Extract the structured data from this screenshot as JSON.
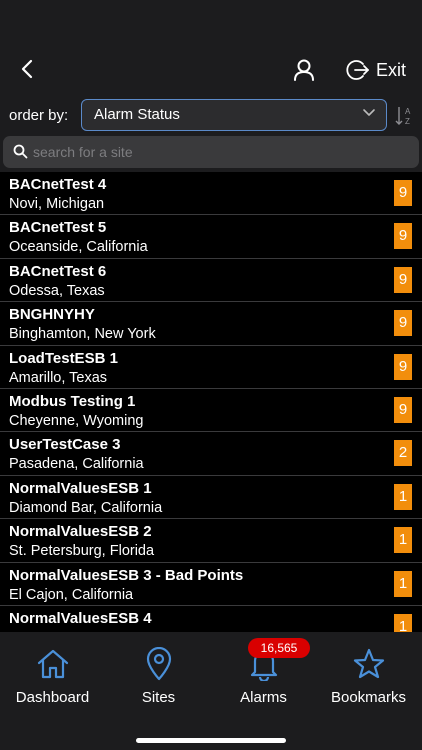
{
  "header": {
    "exit_label": "Exit"
  },
  "order": {
    "label": "order by:",
    "value": "Alarm Status"
  },
  "search": {
    "placeholder": "search for a site"
  },
  "sites": [
    {
      "name": "BACnetTest 4",
      "location": "Novi, Michigan",
      "alarms": "9"
    },
    {
      "name": "BACnetTest 5",
      "location": "Oceanside, California",
      "alarms": "9"
    },
    {
      "name": "BACnetTest 6",
      "location": "Odessa, Texas",
      "alarms": "9"
    },
    {
      "name": "BNGHNYHY",
      "location": "Binghamton, New York",
      "alarms": "9"
    },
    {
      "name": "LoadTestESB 1",
      "location": "Amarillo, Texas",
      "alarms": "9"
    },
    {
      "name": "Modbus Testing 1",
      "location": "Cheyenne, Wyoming",
      "alarms": "9"
    },
    {
      "name": "UserTestCase 3",
      "location": "Pasadena, California",
      "alarms": "2"
    },
    {
      "name": "NormalValuesESB 1",
      "location": "Diamond Bar, California",
      "alarms": "1"
    },
    {
      "name": "NormalValuesESB 2",
      "location": "St. Petersburg, Florida",
      "alarms": "1"
    },
    {
      "name": "NormalValuesESB 3 - Bad Points",
      "location": "El Cajon, California",
      "alarms": "1"
    },
    {
      "name": "NormalValuesESB 4",
      "location": "",
      "alarms": "1"
    }
  ],
  "tabs": {
    "dashboard": "Dashboard",
    "sites": "Sites",
    "alarms": "Alarms",
    "bookmarks": "Bookmarks",
    "alarms_badge": "16,565"
  },
  "colors": {
    "accent": "#5b8ac9",
    "badge": "#f28e0c",
    "alarm_badge": "#d90000"
  }
}
